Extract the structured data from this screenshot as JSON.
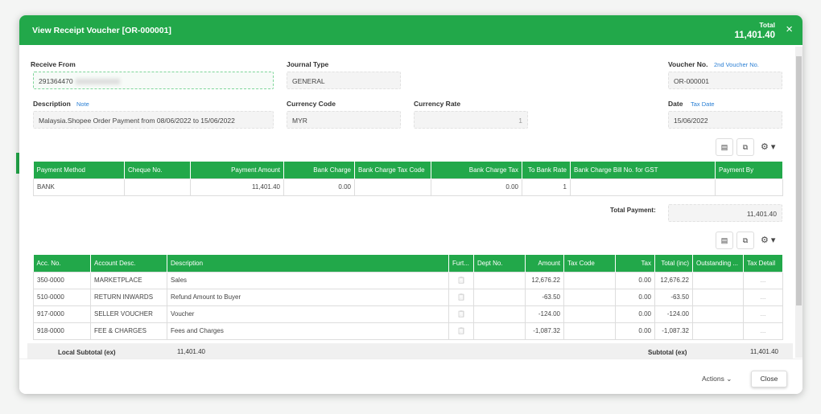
{
  "header": {
    "title": "View Receipt Voucher [OR-000001]",
    "total_label": "Total",
    "total_value": "11,401.40"
  },
  "form": {
    "receive_from": {
      "label": "Receive From",
      "value": "291364470"
    },
    "journal_type": {
      "label": "Journal Type",
      "value": "GENERAL"
    },
    "voucher_no": {
      "label": "Voucher No.",
      "link": "2nd Voucher No.",
      "value": "OR-000001"
    },
    "description": {
      "label": "Description",
      "link": "Note",
      "value": "Malaysia.Shopee Order Payment from 08/06/2022 to 15/06/2022"
    },
    "currency_code": {
      "label": "Currency Code",
      "value": "MYR"
    },
    "currency_rate": {
      "label": "Currency Rate",
      "value": "1"
    },
    "date": {
      "label": "Date",
      "link": "Tax Date",
      "value": "15/06/2022"
    }
  },
  "payment_table": {
    "columns": [
      "Payment Method",
      "Cheque No.",
      "Payment Amount",
      "Bank Charge",
      "Bank Charge Tax Code",
      "Bank Charge Tax",
      "To Bank Rate",
      "Bank Charge Bill No. for GST",
      "Payment By"
    ],
    "rows": [
      [
        "BANK",
        "",
        "11,401.40",
        "0.00",
        "",
        "0.00",
        "1",
        "",
        ""
      ]
    ],
    "total_label": "Total Payment:",
    "total_value": "11,401.40"
  },
  "detail_table": {
    "columns": [
      "Acc. No.",
      "Account Desc.",
      "Description",
      "Furt...",
      "Dept No.",
      "Amount",
      "Tax Code",
      "Tax",
      "Total (inc)",
      "Outstanding ...",
      "Tax Detail"
    ],
    "rows": [
      [
        "350-0000",
        "MARKETPLACE",
        "Sales",
        "",
        "",
        "12,676.22",
        "",
        "0.00",
        "12,676.22",
        "",
        "..."
      ],
      [
        "510-0000",
        "RETURN INWARDS",
        "Refund Amount to Buyer",
        "",
        "",
        "-63.50",
        "",
        "0.00",
        "-63.50",
        "",
        "..."
      ],
      [
        "917-0000",
        "SELLER VOUCHER",
        "Voucher",
        "",
        "",
        "-124.00",
        "",
        "0.00",
        "-124.00",
        "",
        "..."
      ],
      [
        "918-0000",
        "FEE & CHARGES",
        "Fees and Charges",
        "",
        "",
        "-1,087.32",
        "",
        "0.00",
        "-1,087.32",
        "",
        "..."
      ]
    ]
  },
  "subtotal": {
    "local_label": "Local Subtotal (ex)",
    "local_value": "11,401.40",
    "label": "Subtotal (ex)",
    "value": "11,401.40"
  },
  "footer": {
    "actions": "Actions ⌄",
    "close": "Close"
  },
  "icons": {
    "close": "×",
    "gear": "⚙ ▾",
    "csv": "▤",
    "copy": "⧉",
    "clip": "📋"
  },
  "colors": {
    "accent": "#22a84a",
    "link": "#2a7fd4"
  }
}
